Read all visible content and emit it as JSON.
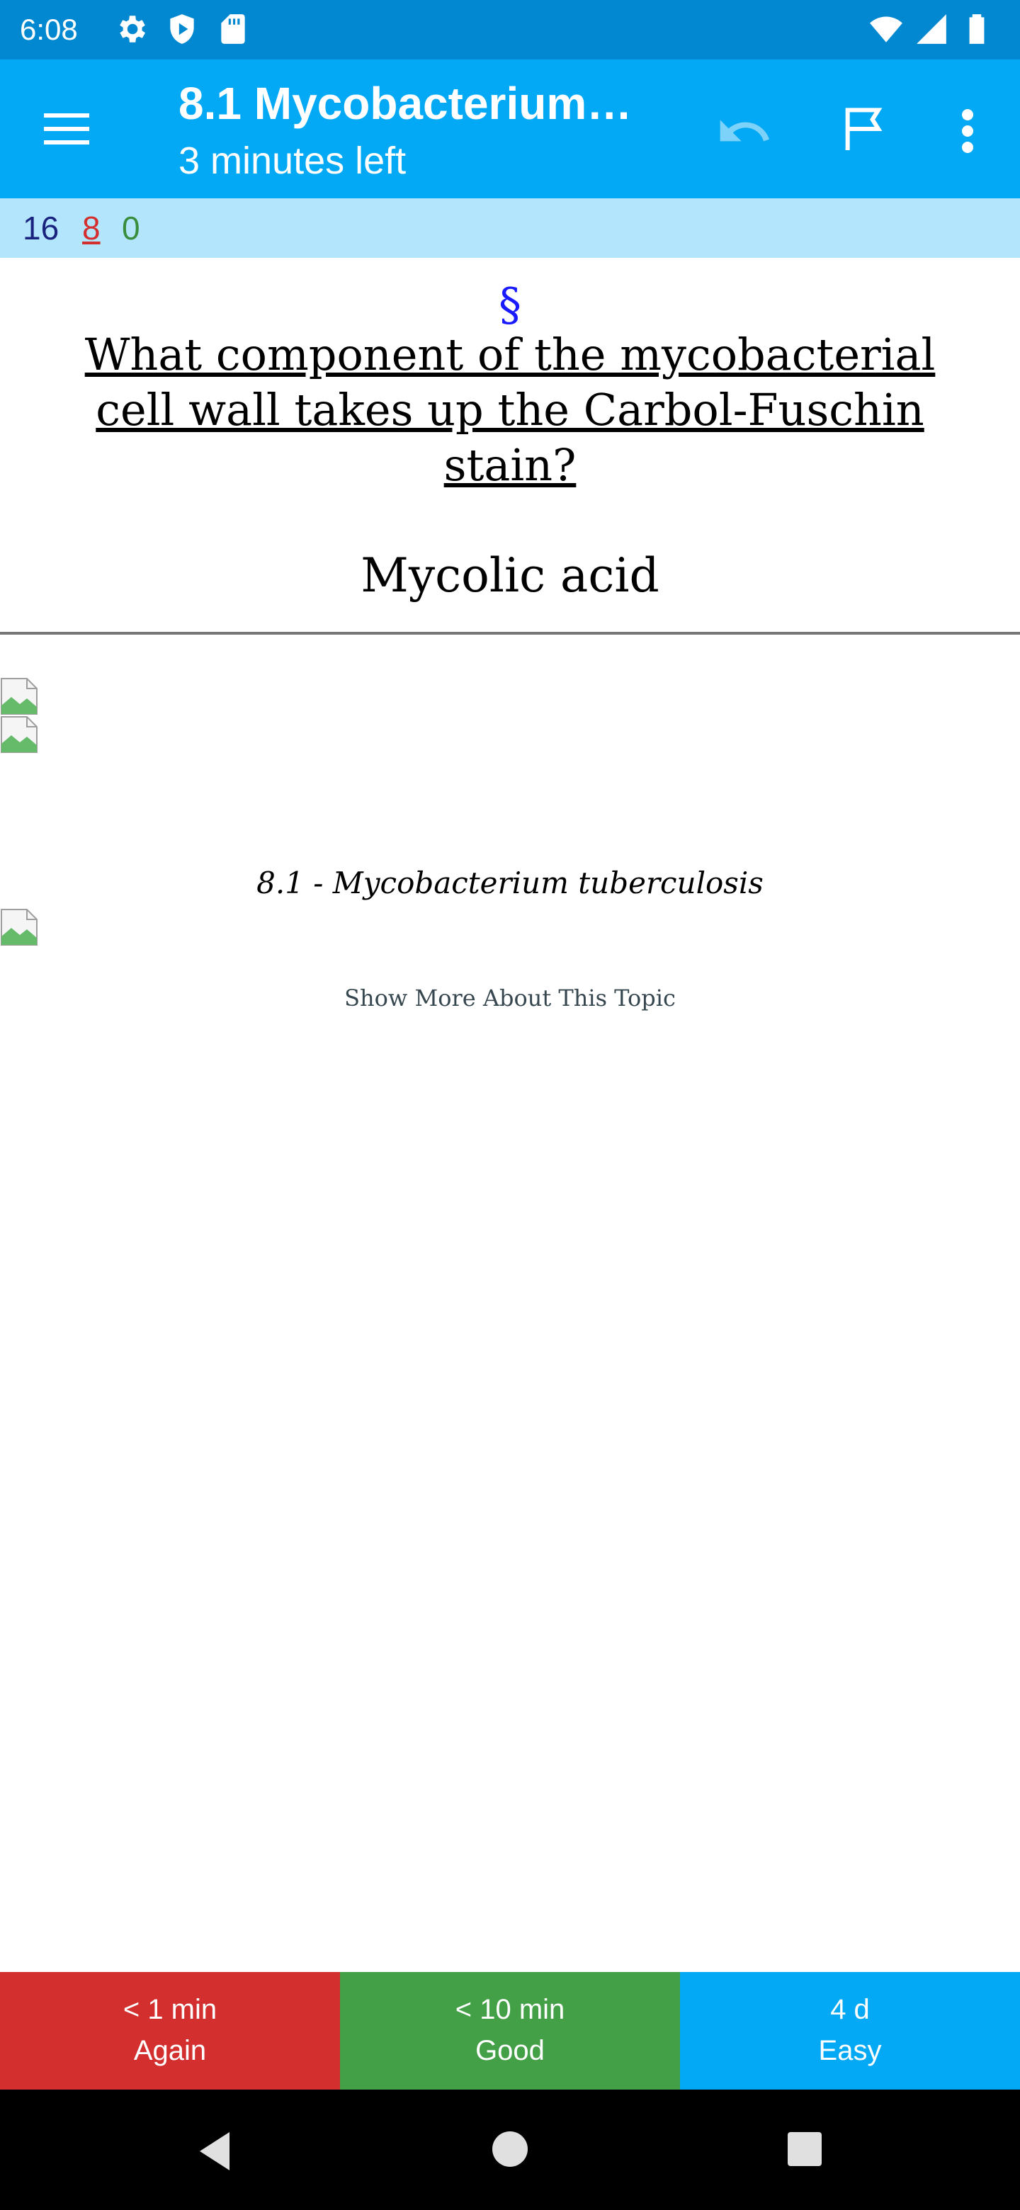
{
  "status_bar": {
    "time": "6:08",
    "icons_left": [
      "settings-icon",
      "shield-icon",
      "sd-card-icon"
    ],
    "icons_right": [
      "wifi-icon",
      "signal-icon",
      "battery-icon"
    ]
  },
  "app_bar": {
    "title": "8.1 Mycobacterium…",
    "subtitle": "3 minutes left",
    "icons": [
      "menu-icon",
      "undo-icon",
      "flag-icon",
      "more-vert-icon"
    ]
  },
  "counts": {
    "new": "16",
    "learning": "8",
    "review": "0"
  },
  "card": {
    "section_mark": "§",
    "question": "What component of the mycobacterial cell wall takes up the Carbol-Fuschin stain?",
    "answer": "Mycolic acid",
    "topic_caption": "8.1 - Mycobacterium tuberculosis",
    "show_more": "Show More About This Topic"
  },
  "answer_buttons": [
    {
      "interval": "< 1 min",
      "label": "Again",
      "color": "#d32f2f"
    },
    {
      "interval": "< 10 min",
      "label": "Good",
      "color": "#43a047"
    },
    {
      "interval": "4 d",
      "label": "Easy",
      "color": "#03a9f4"
    }
  ],
  "nav_bar": {
    "icons": [
      "back-icon",
      "home-icon",
      "recents-icon"
    ]
  },
  "colors": {
    "status_bar": "#0288d1",
    "app_bar": "#03a9f4",
    "counts_bar": "#b3e5fc"
  }
}
